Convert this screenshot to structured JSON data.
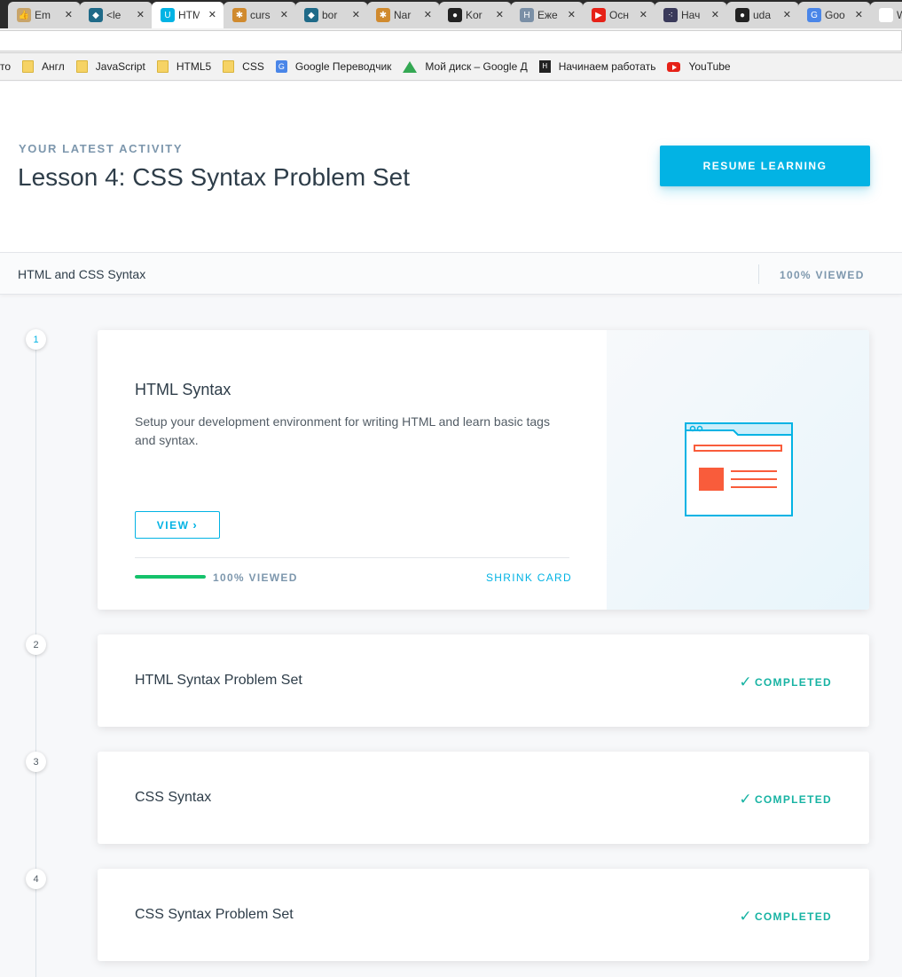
{
  "browser": {
    "tabs": [
      {
        "title": "Em",
        "fav_color": "#c8a46a",
        "fav_glyph": "👍",
        "active": false
      },
      {
        "title": "<le",
        "fav_color": "#1f6a88",
        "fav_glyph": "◆",
        "active": false
      },
      {
        "title": "HTM",
        "fav_color": "#02b3e4",
        "fav_glyph": "U",
        "active": true
      },
      {
        "title": "curs",
        "fav_color": "#d08a2e",
        "fav_glyph": "✱",
        "active": false
      },
      {
        "title": "bor",
        "fav_color": "#1f6a88",
        "fav_glyph": "◆",
        "active": false
      },
      {
        "title": "Nar",
        "fav_color": "#d08a2e",
        "fav_glyph": "✱",
        "active": false
      },
      {
        "title": "Kor",
        "fav_color": "#222222",
        "fav_glyph": "●",
        "active": false
      },
      {
        "title": "Еже",
        "fav_color": "#7a8fa6",
        "fav_glyph": "H",
        "active": false
      },
      {
        "title": "Осн",
        "fav_color": "#e62117",
        "fav_glyph": "▶",
        "active": false
      },
      {
        "title": "Нач",
        "fav_color": "#3a3a5a",
        "fav_glyph": "⁖",
        "active": false
      },
      {
        "title": "uda",
        "fav_color": "#222222",
        "fav_glyph": "●",
        "active": false
      },
      {
        "title": "Goo",
        "fav_color": "#4a86e8",
        "fav_glyph": "G",
        "active": false
      },
      {
        "title": "Wri",
        "fav_color": "#ffffff",
        "fav_glyph": "▯",
        "active": false
      }
    ],
    "bookmarks": [
      {
        "label": "то",
        "kind": "none"
      },
      {
        "label": "Англ",
        "kind": "folder"
      },
      {
        "label": "JavaScript",
        "kind": "folder"
      },
      {
        "label": "HTML5",
        "kind": "folder"
      },
      {
        "label": "CSS",
        "kind": "folder"
      },
      {
        "label": "Google Переводчик",
        "kind": "gtrans"
      },
      {
        "label": "Мой диск – Google Д",
        "kind": "gdrive"
      },
      {
        "label": "Начинаем работать",
        "kind": "ht"
      },
      {
        "label": "YouTube",
        "kind": "yt"
      }
    ]
  },
  "hero": {
    "eyebrow": "YOUR LATEST ACTIVITY",
    "title": "Lesson 4: CSS Syntax Problem Set",
    "resume_label": "RESUME LEARNING"
  },
  "subbar": {
    "name": "HTML and CSS Syntax",
    "viewed": "100% VIEWED"
  },
  "concepts": [
    {
      "number": "1",
      "title": "HTML Syntax",
      "description": "Setup your development environment for writing HTML and learn basic tags and syntax.",
      "view_label": "VIEW",
      "progress_fraction": 1.0,
      "progress_label": "100% VIEWED",
      "shrink_label": "SHRINK CARD"
    },
    {
      "number": "2",
      "title": "HTML Syntax Problem Set",
      "status": "COMPLETED"
    },
    {
      "number": "3",
      "title": "CSS Syntax",
      "status": "COMPLETED"
    },
    {
      "number": "4",
      "title": "CSS Syntax Problem Set",
      "status": "COMPLETED"
    }
  ],
  "colors": {
    "accent": "#02b3e4",
    "progress": "#15c26b",
    "completed": "#17b3a3",
    "illustration_line": "#02b3e4",
    "illustration_accent": "#f95c3b"
  }
}
